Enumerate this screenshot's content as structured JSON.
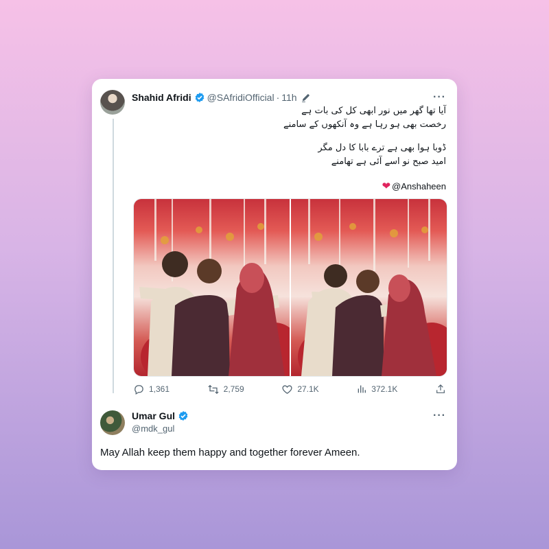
{
  "tweet": {
    "author_name": "Shahid Afridi",
    "handle": "@SAfridiOfficial",
    "separator": "·",
    "time": "11h",
    "lines": [
      "آیا تھا گھر میں نور ابھی کل کی بات ہے",
      "رخصت بھی ہو رہا ہے  وہ آنکھوں کے سامنے",
      "ڈوبا ہوا بھی ہے ترے بابا کا دل مگر",
      "امید صبح نو اسے آئی ہے تھامنے"
    ],
    "mention": "@Anshaheen",
    "mention_emoji": "❤",
    "stats": {
      "replies": "1,361",
      "retweets": "2,759",
      "likes": "27.1K",
      "views": "372.1K"
    }
  },
  "reply": {
    "author_name": "Umar Gul",
    "handle": "@mdk_gul",
    "text": "May Allah keep them happy and together forever Ameen."
  },
  "icons": {
    "verified": "verified-badge-icon",
    "edit": "edit-pen-icon",
    "more": "more-dots-icon",
    "reply": "reply-icon",
    "retweet": "retweet-icon",
    "like": "heart-icon",
    "views": "views-icon",
    "share": "share-icon"
  },
  "colors": {
    "verified_blue": "#1d9bf0",
    "heart_red": "#e0245e",
    "text_primary": "#0f1419",
    "text_secondary": "#536471"
  },
  "more_label": "···"
}
